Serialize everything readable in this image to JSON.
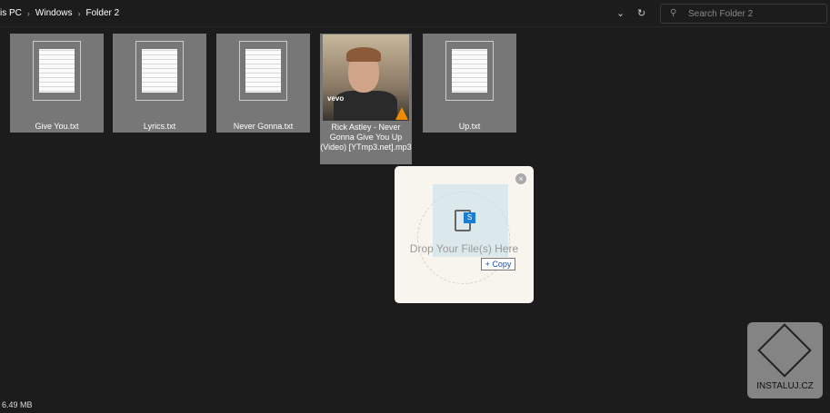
{
  "breadcrumb": [
    "is PC",
    "Windows",
    "Folder 2"
  ],
  "search": {
    "placeholder": "Search Folder 2"
  },
  "files": [
    {
      "name": "Give You.txt"
    },
    {
      "name": "Lyrics.txt"
    },
    {
      "name": "Never Gonna.txt"
    },
    {
      "name": "Rick Astley - Never Gonna Give You Up (Video) [YTmp3.net].mp3",
      "thumb_label": "vevo"
    },
    {
      "name": "Up.txt"
    }
  ],
  "dropzone": {
    "text": "Drop Your File(s) Here",
    "badge": "S",
    "copy_label": "+ Copy"
  },
  "status": {
    "size": "6.49 MB"
  },
  "watermark": "INSTALUJ.CZ"
}
